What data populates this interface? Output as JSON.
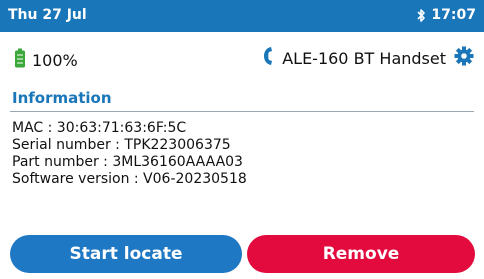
{
  "status": {
    "date": "Thu 27 Jul",
    "time": "17:07",
    "bluetooth_icon": "bluetooth-icon"
  },
  "device": {
    "battery_level": "100%",
    "battery_icon": "battery-full-icon",
    "handset_icon": "phone-handset-icon",
    "name": "ALE-160 BT Handset",
    "settings_icon": "gear-icon"
  },
  "information": {
    "title": "Information",
    "mac": "MAC : 30:63:71:63:6F:5C",
    "serial": "Serial number : TPK223006375",
    "part": "Part number : 3ML36160AAAA03",
    "software": "Software version : V06-20230518"
  },
  "actions": {
    "locate_label": "Start locate",
    "remove_label": "Remove"
  },
  "colors": {
    "accent": "#1976b8",
    "locate_button": "#1f78c4",
    "remove_button": "#e30b3e",
    "battery": "#3aa83a"
  }
}
